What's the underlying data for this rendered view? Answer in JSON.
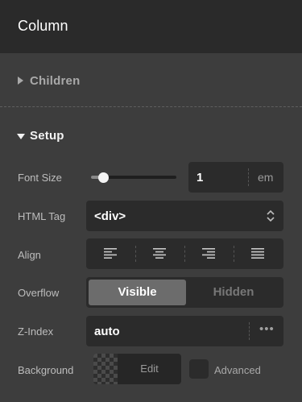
{
  "header": {
    "title": "Column"
  },
  "sections": {
    "children": {
      "label": "Children",
      "expanded": false
    },
    "setup": {
      "label": "Setup",
      "expanded": true
    }
  },
  "font_size": {
    "label": "Font Size",
    "value": "1",
    "unit": "em",
    "slider_fraction": 0.1
  },
  "html_tag": {
    "label": "HTML Tag",
    "value": "<div>"
  },
  "align": {
    "label": "Align",
    "options": [
      "align-left-icon",
      "align-center-icon",
      "align-right-icon",
      "align-justify-icon"
    ]
  },
  "overflow": {
    "label": "Overflow",
    "options": [
      "Visible",
      "Hidden"
    ],
    "selected": "Visible"
  },
  "z_index": {
    "label": "Z-Index",
    "value": "auto",
    "more": "•••"
  },
  "background": {
    "label": "Background",
    "edit_label": "Edit",
    "advanced_label": "Advanced"
  },
  "colors": {
    "panel": "#3d3d3d",
    "header": "#2a2a2a",
    "field": "#2b2b2b",
    "selected": "#6c6c6c"
  }
}
